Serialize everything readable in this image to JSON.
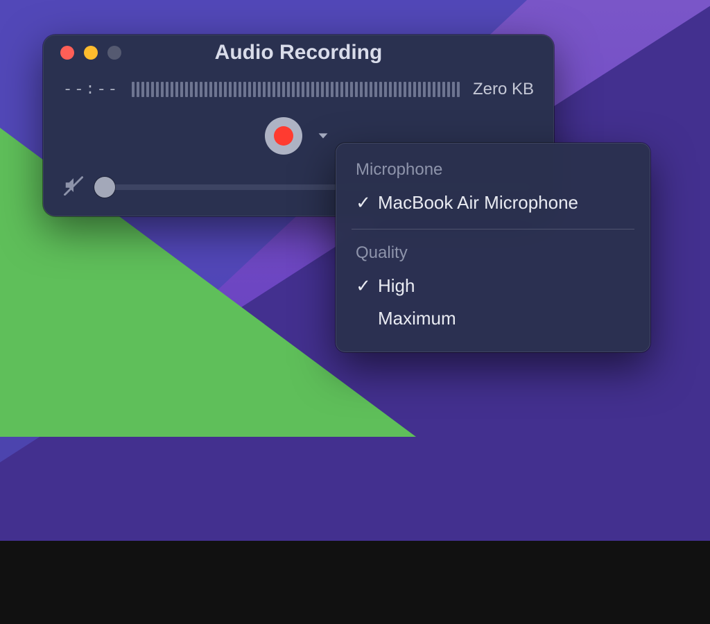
{
  "window": {
    "title": "Audio Recording",
    "time_placeholder": "--:--",
    "file_size": "Zero KB"
  },
  "dropdown": {
    "microphone_section": "Microphone",
    "microphone_items": [
      {
        "label": "MacBook Air Microphone",
        "checked": true
      }
    ],
    "quality_section": "Quality",
    "quality_items": [
      {
        "label": "High",
        "checked": true
      },
      {
        "label": "Maximum",
        "checked": false
      }
    ]
  },
  "icons": {
    "close": "close-icon",
    "minimize": "minimize-icon",
    "disabled": "disabled-icon",
    "record": "record-icon",
    "chevron": "chevron-down-icon",
    "mute": "speaker-muted-icon"
  },
  "colors": {
    "window_bg": "#2a3150",
    "accent_record": "#ff3b30",
    "text": "#dfe3ec"
  }
}
